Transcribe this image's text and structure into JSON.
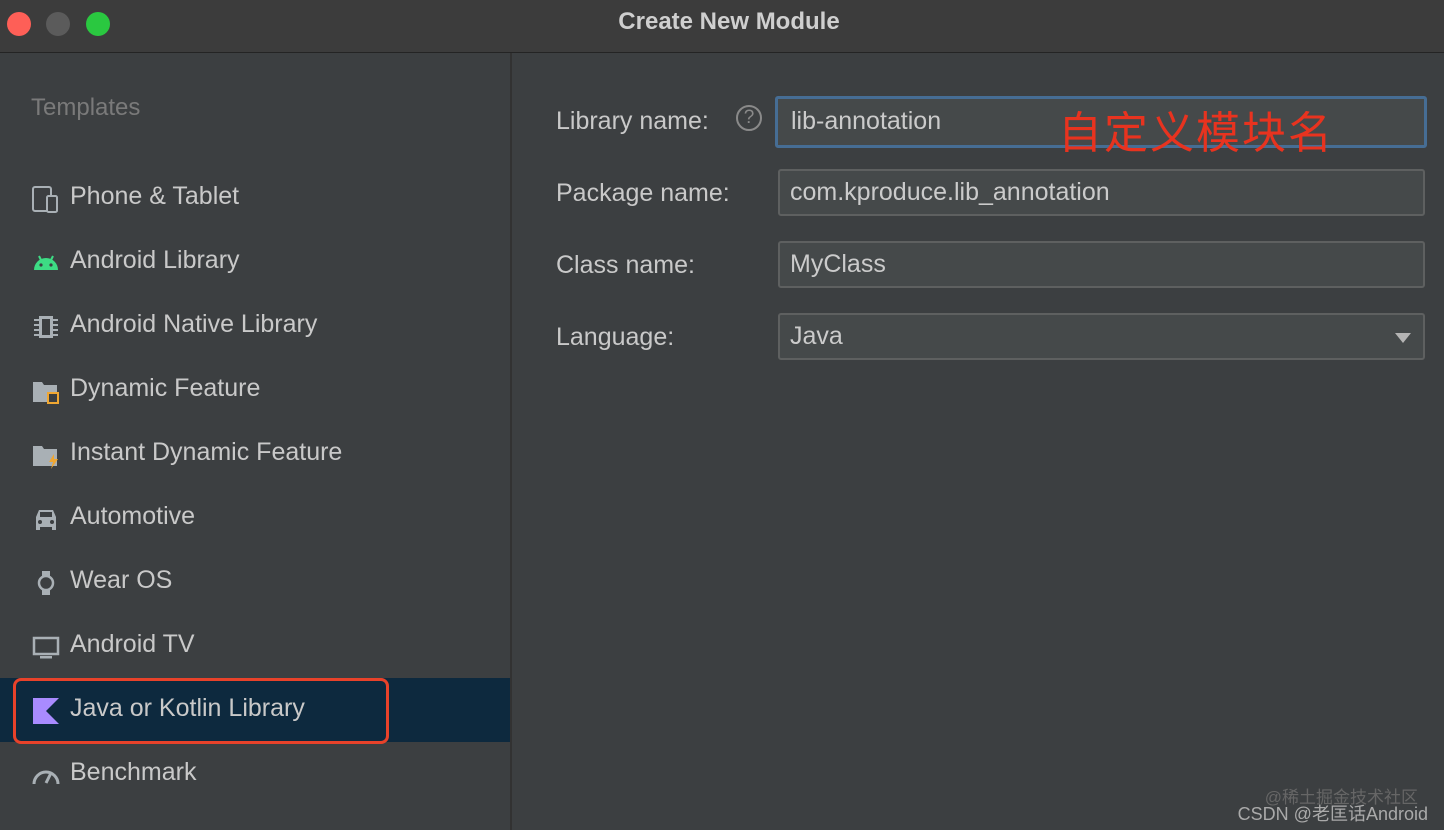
{
  "window": {
    "title": "Create New Module"
  },
  "sidebar": {
    "heading": "Templates",
    "items": [
      {
        "label": "Phone & Tablet",
        "icon": "phone-tablet-icon"
      },
      {
        "label": "Android Library",
        "icon": "android-icon"
      },
      {
        "label": "Android Native Library",
        "icon": "native-chip-icon"
      },
      {
        "label": "Dynamic Feature",
        "icon": "dynamic-feature-folder-icon"
      },
      {
        "label": "Instant Dynamic Feature",
        "icon": "instant-feature-folder-icon"
      },
      {
        "label": "Automotive",
        "icon": "car-icon"
      },
      {
        "label": "Wear OS",
        "icon": "watch-icon"
      },
      {
        "label": "Android TV",
        "icon": "tv-icon"
      },
      {
        "label": "Java or Kotlin Library",
        "icon": "kotlin-icon",
        "selected": true
      },
      {
        "label": "Benchmark",
        "icon": "gauge-icon"
      }
    ]
  },
  "form": {
    "library_name": {
      "label": "Library name:",
      "value": "lib-annotation"
    },
    "package_name": {
      "label": "Package name:",
      "value": "com.kproduce.lib_annotation"
    },
    "class_name": {
      "label": "Class name:",
      "value": "MyClass"
    },
    "language": {
      "label": "Language:",
      "value": "Java"
    }
  },
  "annotation": {
    "text": "自定义模块名",
    "color": "#e8331f"
  },
  "watermark": {
    "line1": "@稀土掘金技术社区",
    "line2": "CSDN @老匡话Android"
  },
  "colors": {
    "accent": "#466d94",
    "selection": "#0d293e",
    "highlight": "#e8422a"
  }
}
